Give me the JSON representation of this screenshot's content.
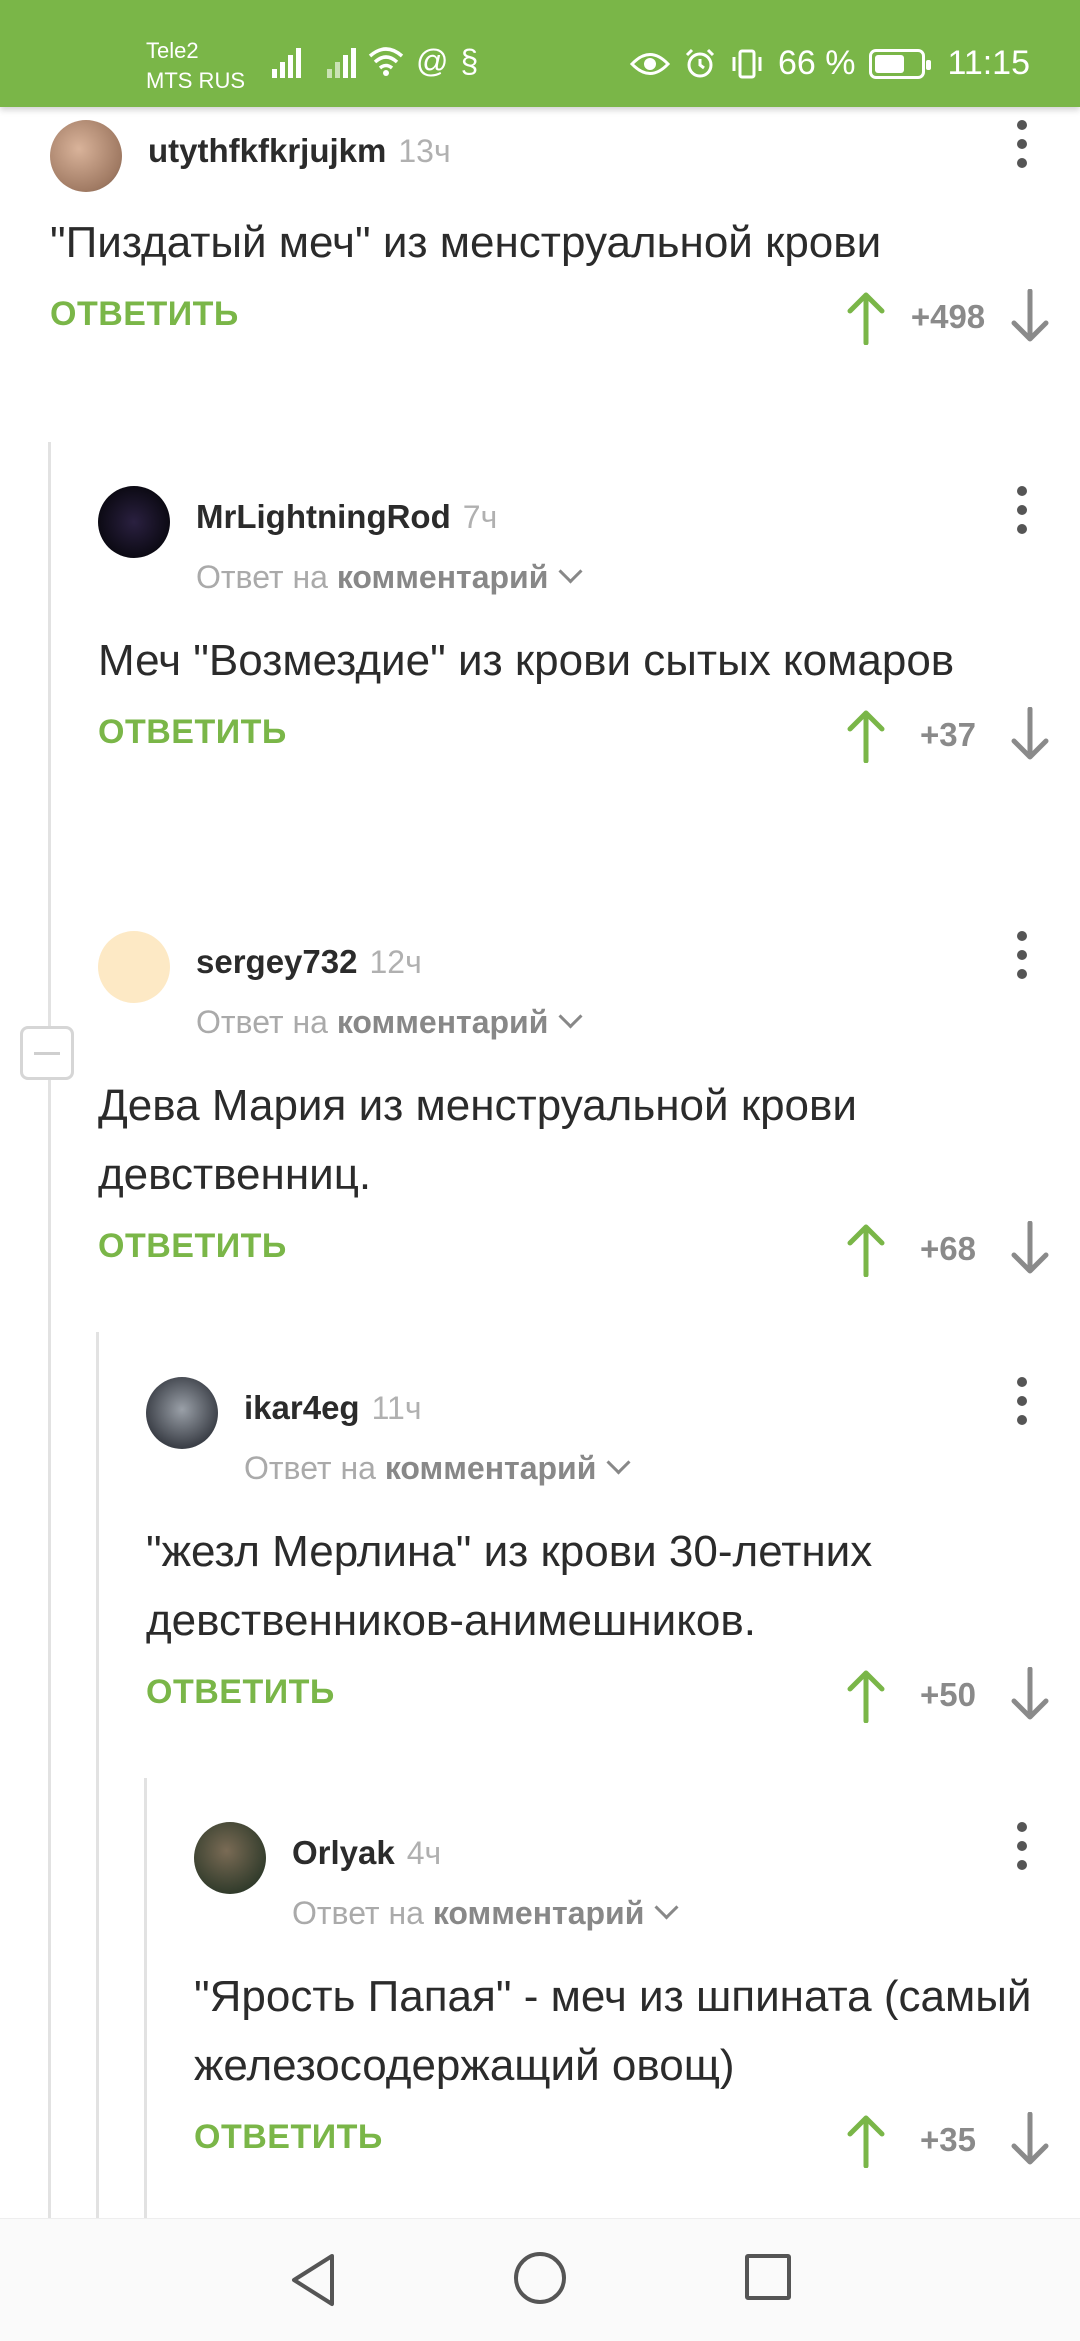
{
  "status_bar": {
    "carrier_1": "Tele2",
    "carrier_2": "MTS RUS",
    "battery_percent": "66 %",
    "battery_level": 0.66,
    "time": "11:15"
  },
  "colors": {
    "accent": "#7ab648",
    "upvote": "#7ab648",
    "downvote": "#8a8a8a"
  },
  "comments": [
    {
      "author": "utythfkfkrjujkm",
      "time": "13ч",
      "text": "\"Пиздатый меч\" из менструальной крови",
      "reply_label": "ОТВЕТИТЬ",
      "score": "+498"
    },
    {
      "author": "MrLightningRod",
      "time": "7ч",
      "reply_to_prefix": "Ответ на",
      "reply_to_target": "комментарий",
      "text": "Меч \"Возмездие\" из крови сытых комаров",
      "reply_label": "ОТВЕТИТЬ",
      "score": "+37"
    },
    {
      "author": "sergey732",
      "time": "12ч",
      "reply_to_prefix": "Ответ на",
      "reply_to_target": "комментарий",
      "text": "Дева Мария из менструальной крови девственниц.",
      "reply_label": "ОТВЕТИТЬ",
      "score": "+68"
    },
    {
      "author": "ikar4eg",
      "time": "11ч",
      "reply_to_prefix": "Ответ на",
      "reply_to_target": "комментарий",
      "text": "\"жезл Мерлина\" из крови 30-летних девственников-анимешников.",
      "reply_label": "ОТВЕТИТЬ",
      "score": "+50"
    },
    {
      "author": "Orlyak",
      "time": "4ч",
      "reply_to_prefix": "Ответ на",
      "reply_to_target": "комментарий",
      "text": "\"Ярость Папая\" - меч из шпината (самый железосодержащий овощ)",
      "reply_label": "ОТВЕТИТЬ",
      "score": "+35"
    }
  ]
}
